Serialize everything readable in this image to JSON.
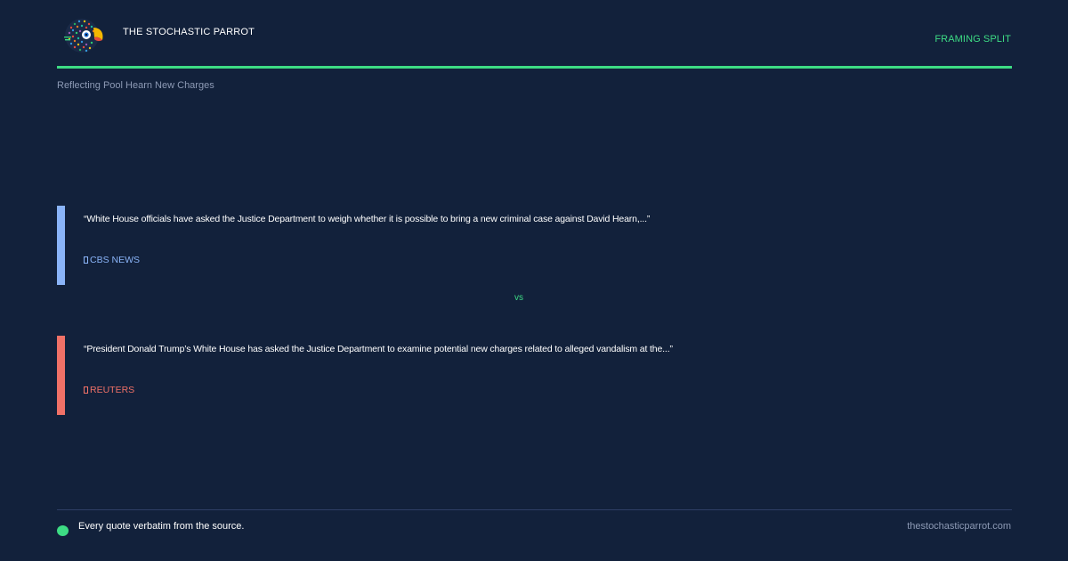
{
  "header": {
    "brand_name": "THE STOCHASTIC PARROT",
    "framing_label": "FRAMING SPLIT"
  },
  "story": {
    "title": "Reflecting Pool Hearn New Charges"
  },
  "comparison": {
    "divider_label": "vs",
    "quotes": [
      {
        "text": "“White House officials have asked the Justice Department to weigh whether it is possible to bring a new criminal case against David Hearn,...”",
        "source": "CBS NEWS",
        "color": "#8ab4f8"
      },
      {
        "text": "“President Donald Trump’s White House has asked the Justice Department to examine potential new charges related to alleged vandalism at the...”",
        "source": "REUTERS",
        "color": "#f07167"
      }
    ]
  },
  "footer": {
    "note": "Every quote verbatim from the source.",
    "url": "thestochasticparrot.com"
  },
  "colors": {
    "background": "#12213b",
    "accent": "#3ddc84",
    "muted": "#8d9ab5"
  }
}
